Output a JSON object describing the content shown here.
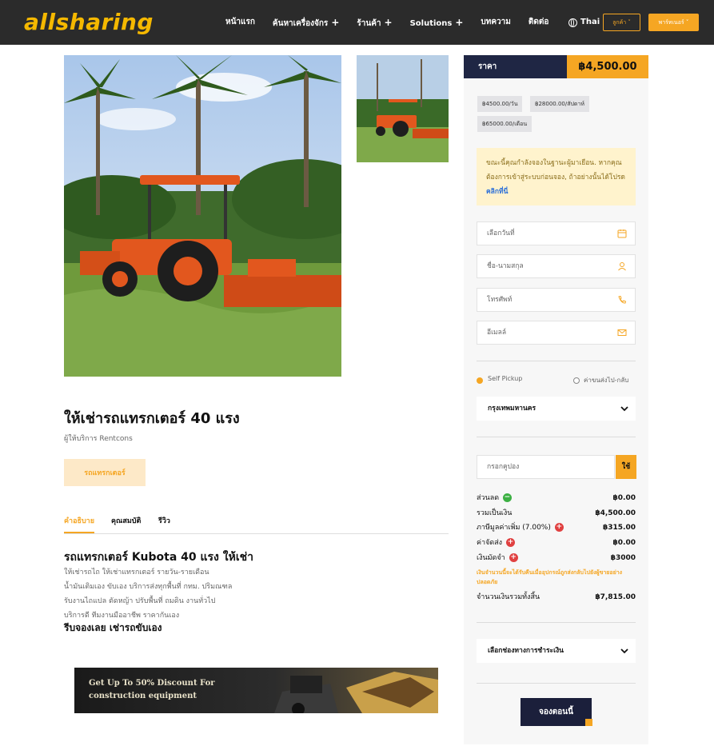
{
  "header": {
    "logo": "allsharing",
    "nav": [
      {
        "label": "หน้าแรก",
        "has_plus": false
      },
      {
        "label": "ค้นหาเครื่องจักร",
        "has_plus": true
      },
      {
        "label": "ร้านค้า",
        "has_plus": true
      },
      {
        "label": "Solutions",
        "has_plus": true
      },
      {
        "label": "บทความ",
        "has_plus": false
      },
      {
        "label": "ติดต่อ",
        "has_plus": false
      }
    ],
    "language": "Thai",
    "customer_button": "ลูกค้า ˅",
    "partner_button": "พาร์ทเนอร์ ˅"
  },
  "product": {
    "title": "ให้เช่ารถแทรกเตอร์ 40 แรง",
    "provider": "ผู้ให้บริการ Rentcons",
    "category": "รถแทรกเตอร์"
  },
  "tabs": [
    {
      "label": "คำอธิบาย",
      "active": true
    },
    {
      "label": "คุณสมบัติ",
      "active": false
    },
    {
      "label": "รีวิว",
      "active": false
    }
  ],
  "description": {
    "title": "รถแทรกเตอร์ Kubota 40 แรง ให้เช่า",
    "lines": [
      "ให้เช่ารถไถ ให้เช่าแทรกเตอร์ รายวัน-รายเดือน",
      "น้ำมันเติมเอง ขับเอง บริการส่งทุกพื้นที่ กทม. ปริมณฑล",
      "รับงานไถแปล ตัดหญ้า ปรับพื้นที่ ถมดิน งานทั่วไป",
      "บริการดี ทีมงานมืออาชีพ ราคากันเอง"
    ],
    "cta": "รีบจองเลย เช่ารถขับเอง"
  },
  "banner": {
    "line1": "Get Up To 50% Discount For",
    "line2": "construction equipment"
  },
  "booking": {
    "price_label": "ราคา",
    "price_value": "฿4,500.00",
    "rates": [
      "฿4500.00/วัน",
      "฿28000.00/สัปดาห์",
      "฿65000.00/เดือน"
    ],
    "notice_text": "ขณะนี้คุณกำลังจองในฐานะผู้มาเยือน. หากคุณต้องการเข้าสู่ระบบก่อนจอง, ถ้าอย่างนั้นได้โปรด",
    "notice_link": "คลิกที่นี่",
    "fields": {
      "date": "เลือกวันที่",
      "name": "ชื่อ-นามสกุล",
      "phone": "โทรศัพท์",
      "email": "อีเมลล์"
    },
    "delivery_options": [
      {
        "label": "Self Pickup",
        "selected": true
      },
      {
        "label": "ค่าขนส่งไป-กลับ",
        "selected": false
      }
    ],
    "province": "กรุงเทพมหานคร",
    "coupon_placeholder": "กรอกคูปอง",
    "coupon_button": "ใช้",
    "summary": {
      "discount_label": "ส่วนลด",
      "discount_value": "฿0.00",
      "subtotal_label": "รวมเป็นเงิน",
      "subtotal_value": "฿4,500.00",
      "vat_label": "ภาษีมูลค่าเพิ่ม (7.00%)",
      "vat_value": "฿315.00",
      "shipping_label": "ค่าจัดส่ง",
      "shipping_value": "฿0.00",
      "deposit_label": "เงินมัดจำ",
      "deposit_value": "฿3000",
      "deposit_note": "เงินจำนวนนี้จะได้รับคืนเมื่ออุปกรณ์ถูกส่งกลับไปยังผู้ขายอย่างปลอดภัย",
      "total_label": "จำนวนเงินรวมทั้งสิ้น",
      "total_value": "฿7,815.00"
    },
    "payment_select": "เลือกช่องทางการชำระเงิน",
    "book_button": "จองตอนนี้"
  },
  "colors": {
    "accent": "#f5a623",
    "navy": "#1f2644",
    "header_bg": "#2b2b2b",
    "logo": "#f5b800"
  }
}
